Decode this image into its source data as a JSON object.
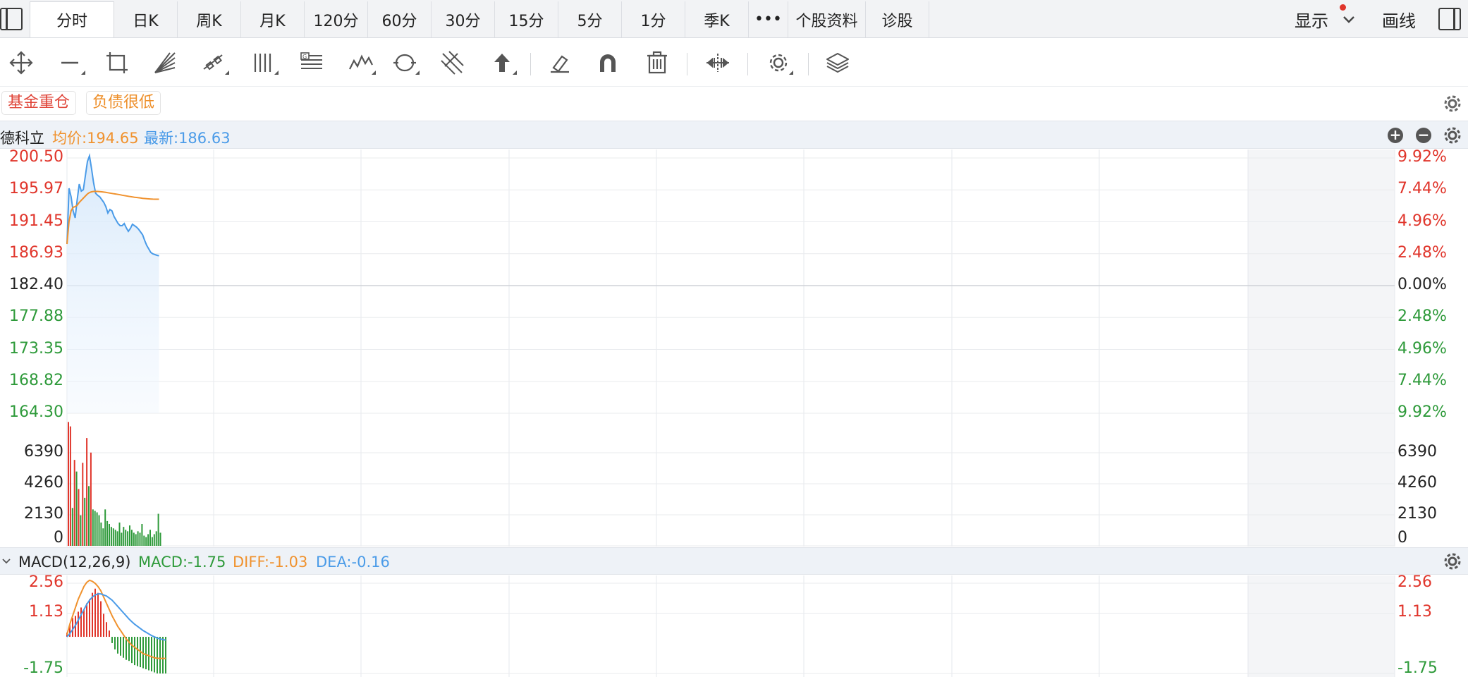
{
  "tabs": [
    "分时",
    "日K",
    "周K",
    "月K",
    "120分",
    "60分",
    "30分",
    "15分",
    "5分",
    "1分",
    "季K",
    "•••",
    "个股资料",
    "诊股"
  ],
  "active_tab": 0,
  "header_right": {
    "display_label": "显示",
    "draw_label": "画线"
  },
  "tags": [
    {
      "label": "基金重仓",
      "color": "#e0463a"
    },
    {
      "label": "负债很低",
      "color": "#ee8f2a"
    }
  ],
  "stock": {
    "name": "德科立",
    "avg_label": "均价:194.65",
    "last_label": "最新:186.63"
  },
  "colors": {
    "up": "#e0352b",
    "down": "#2e9a3a",
    "price_line": "#4a9be8",
    "avg_line": "#f0922e",
    "diff_line": "#f0922e",
    "dea_line": "#4a9be8",
    "flat": "#222222"
  },
  "price_axis": {
    "left": [
      "200.50",
      "195.97",
      "191.45",
      "186.93",
      "182.40",
      "177.88",
      "173.35",
      "168.82",
      "164.30"
    ],
    "right": [
      "9.92%",
      "7.44%",
      "4.96%",
      "2.48%",
      "0.00%",
      "2.48%",
      "4.96%",
      "7.44%",
      "9.92%"
    ],
    "values": [
      200.5,
      195.97,
      191.45,
      186.93,
      182.4,
      177.88,
      173.35,
      168.82,
      164.3
    ]
  },
  "volume_axis": {
    "labels": [
      "6390",
      "4260",
      "2130",
      "0"
    ],
    "values": [
      6390,
      4260,
      2130,
      0
    ],
    "max": 8520
  },
  "macd": {
    "title": "MACD(12,26,9)",
    "macd_label": "MACD:-1.75",
    "diff_label": "DIFF:-1.03",
    "dea_label": "DEA:-0.16",
    "axis_labels": [
      "2.56",
      "1.13",
      "-1.75"
    ],
    "axis_values": [
      2.56,
      1.13,
      -1.75
    ]
  },
  "chart_data": {
    "type": "line",
    "intraday_minutes_total": 240,
    "price_line": [
      188.3,
      196.2,
      195.0,
      193.0,
      192.0,
      194.6,
      196.8,
      195.8,
      196.0,
      198.0,
      200.0,
      200.8,
      199.0,
      197.0,
      195.5,
      195.2,
      195.0,
      194.6,
      194.2,
      193.6,
      192.7,
      193.2,
      193.0,
      192.2,
      191.7,
      191.2,
      190.9,
      190.9,
      191.2,
      190.6,
      190.1,
      190.5,
      191.1,
      190.9,
      190.7,
      190.4,
      190.0,
      189.6,
      188.8,
      188.1,
      187.6,
      187.1,
      186.9,
      186.8,
      186.7,
      186.63
    ],
    "avg_line": [
      188.3,
      191.5,
      193.0,
      193.5,
      193.6,
      193.8,
      194.2,
      194.5,
      194.8,
      195.1,
      195.4,
      195.6,
      195.7,
      195.75,
      195.76,
      195.75,
      195.73,
      195.7,
      195.66,
      195.62,
      195.57,
      195.52,
      195.47,
      195.42,
      195.38,
      195.33,
      195.28,
      195.22,
      195.17,
      195.12,
      195.07,
      195.02,
      194.98,
      194.93,
      194.9,
      194.86,
      194.82,
      194.78,
      194.75,
      194.72,
      194.7,
      194.68,
      194.66,
      194.65,
      194.65,
      194.65
    ],
    "volume": [
      8500,
      8200,
      2600,
      5900,
      5100,
      3900,
      2100,
      5700,
      3300,
      7400,
      4100,
      6400,
      2500,
      2400,
      2300,
      2100,
      1600,
      1200,
      2500,
      1700,
      1500,
      1300,
      1200,
      1100,
      1000,
      1600,
      900,
      1300,
      1100,
      1000,
      1400,
      1100,
      900,
      800,
      1000,
      900,
      1500,
      700,
      600,
      800,
      1100,
      600,
      800,
      1000,
      2200,
      900
    ],
    "volume_up": [
      true,
      true,
      false,
      true,
      false,
      true,
      false,
      true,
      false,
      true,
      false,
      true,
      false,
      false,
      false,
      false,
      false,
      false,
      false,
      false,
      false,
      false,
      false,
      false,
      false,
      false,
      false,
      false,
      false,
      false,
      false,
      false,
      false,
      false,
      false,
      false,
      false,
      false,
      false,
      false,
      false,
      false,
      false,
      false,
      false,
      false
    ],
    "macd_hist": [
      0.2,
      0.6,
      0.9,
      1.0,
      1.2,
      1.4,
      1.3,
      1.6,
      1.8,
      2.1,
      2.3,
      2.1,
      1.7,
      1.1,
      0.7,
      0.3,
      -0.3,
      -0.6,
      -0.8,
      -0.9,
      -1.0,
      -1.1,
      -1.15,
      -1.25,
      -1.35,
      -1.4,
      -1.45,
      -1.5,
      -1.55,
      -1.6,
      -1.65,
      -1.7,
      -1.75,
      -1.75,
      -1.75,
      -1.75
    ],
    "diff_line": [
      0.1,
      0.6,
      1.0,
      1.4,
      1.8,
      2.1,
      2.4,
      2.6,
      2.7,
      2.65,
      2.55,
      2.4,
      2.2,
      1.9,
      1.6,
      1.3,
      1.0,
      0.75,
      0.5,
      0.3,
      0.1,
      -0.1,
      -0.25,
      -0.4,
      -0.5,
      -0.6,
      -0.7,
      -0.8,
      -0.85,
      -0.9,
      -0.95,
      -1.0,
      -1.02,
      -1.03,
      -1.03,
      -1.03
    ],
    "dea_line": [
      0.0,
      0.15,
      0.35,
      0.55,
      0.8,
      1.05,
      1.3,
      1.55,
      1.75,
      1.9,
      2.0,
      2.05,
      2.05,
      2.0,
      1.95,
      1.85,
      1.75,
      1.6,
      1.45,
      1.3,
      1.15,
      1.0,
      0.85,
      0.72,
      0.6,
      0.5,
      0.4,
      0.3,
      0.22,
      0.14,
      0.06,
      0.0,
      -0.06,
      -0.1,
      -0.13,
      -0.16
    ]
  }
}
